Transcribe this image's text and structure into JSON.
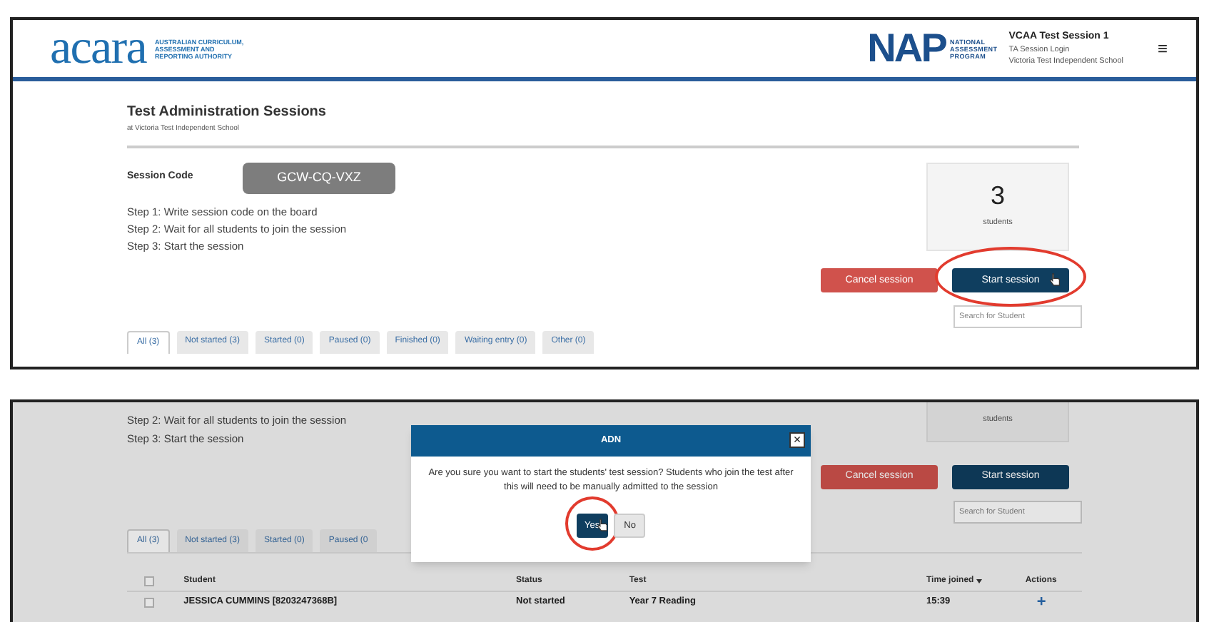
{
  "top_screen": {
    "header": {
      "logo": "acara",
      "logo_caption": [
        "AUSTRALIAN CURRICULUM,",
        "ASSESSMENT AND",
        "REPORTING AUTHORITY"
      ],
      "program_logo": "NAP",
      "program_caption": [
        "NATIONAL",
        "ASSESSMENT",
        "PROGRAM"
      ],
      "session_name": "VCAA Test Session 1",
      "login_type": "TA Session Login",
      "school": "Victoria Test Independent School",
      "menu": "≡"
    },
    "title": "Test Administration Sessions",
    "subtitle": "at Victoria Test Independent School",
    "session_code_label": "Session Code",
    "session_code": "GCW-CQ-VXZ",
    "steps": [
      "Step 1: Write session code on the board",
      "Step 2: Wait for all students to join the session",
      "Step 3: Start the session"
    ],
    "student_count": "3",
    "student_count_label": "students",
    "buttons": [
      {
        "label": "Cancel session",
        "kind": "cancel",
        "highlighted": false
      },
      {
        "label": "Start session",
        "kind": "start",
        "highlighted": true
      }
    ],
    "search": {
      "placeholder": "Search for Student"
    },
    "tabs": [
      {
        "label": "All (3)",
        "selected": true
      },
      {
        "label": "Not started (3)",
        "selected": false
      },
      {
        "label": "Started (0)",
        "selected": false
      },
      {
        "label": "Paused (0)",
        "selected": false
      },
      {
        "label": "Finished (0)",
        "selected": false
      },
      {
        "label": "Waiting entry (0)",
        "selected": false
      },
      {
        "label": "Other (0)",
        "selected": false
      }
    ]
  },
  "bottom_screen": {
    "steps": [
      "Step 2: Wait for all students to join the session",
      "Step 3: Start the session"
    ],
    "student_count_label": "students",
    "buttons": [
      {
        "label": "Cancel session",
        "kind": "cancel"
      },
      {
        "label": "Start session",
        "kind": "start"
      }
    ],
    "search": {
      "placeholder": "Search for Student"
    },
    "tabs": [
      {
        "label": "All (3)",
        "selected": true
      },
      {
        "label": "Not started (3)",
        "selected": false
      },
      {
        "label": "Started (0)",
        "selected": false
      },
      {
        "label": "Paused (0",
        "selected": false
      }
    ],
    "dialog": {
      "title": "ADN",
      "close": "×",
      "message": "Are you sure you want to start the students' test session? Students who join the test after this will need to be manually admitted to the session",
      "buttons": [
        {
          "label": "Yes",
          "kind": "primary",
          "highlighted": true
        },
        {
          "label": "No",
          "kind": "secondary",
          "highlighted": false
        }
      ]
    },
    "table": {
      "select_all_checked": false,
      "columns": [
        {
          "label": "Student",
          "kind": "text"
        },
        {
          "label": "Status",
          "kind": "text"
        },
        {
          "label": "Test",
          "kind": "text"
        },
        {
          "label": "Time joined",
          "kind": "sorted"
        },
        {
          "label": "Actions",
          "kind": "text"
        }
      ],
      "rows": [
        {
          "checked": false,
          "cells": [
            "JESSICA CUMMINS [8203247368B]",
            "Not started",
            "Year 7 Reading",
            "15:39",
            "+"
          ]
        }
      ]
    }
  }
}
